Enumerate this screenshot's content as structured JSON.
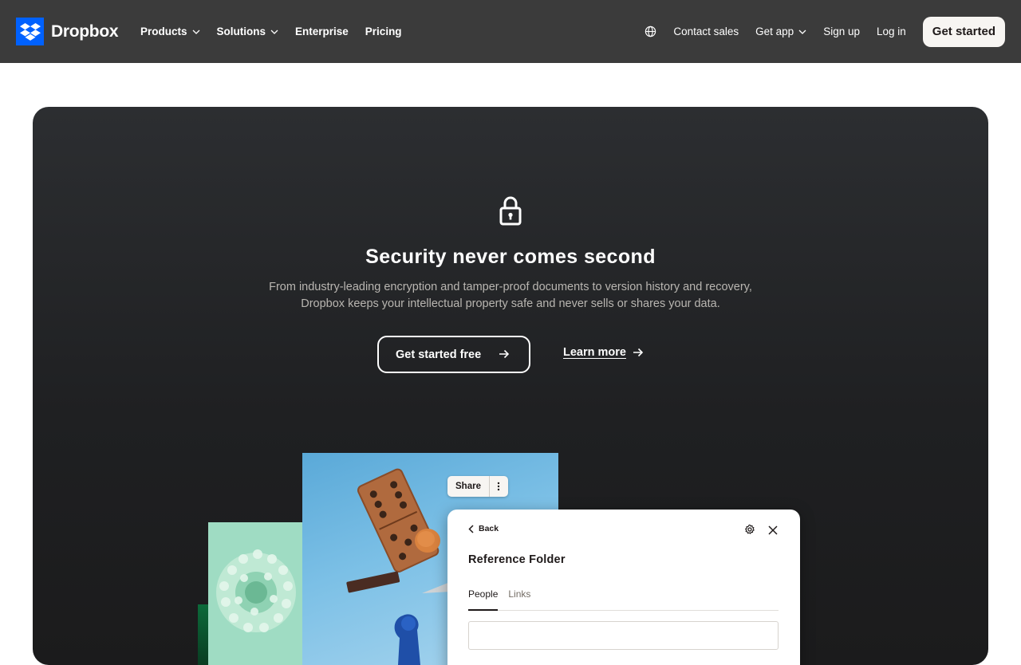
{
  "nav": {
    "brand": "Dropbox",
    "links": [
      "Products",
      "Solutions",
      "Enterprise",
      "Pricing"
    ],
    "right": {
      "contact": "Contact sales",
      "get_app": "Get app",
      "sign_up": "Sign up",
      "log_in": "Log in",
      "cta": "Get started"
    },
    "brand_color": "#0061fe",
    "icons": [
      "dropbox-logo-icon",
      "chevron-down-icon",
      "globe-icon"
    ]
  },
  "hero": {
    "title": "Security never comes second",
    "subtitle_line1": "From industry-leading encryption and tamper-proof documents to version history and recovery,",
    "subtitle_line2": "Dropbox keeps your intellectual property safe and never sells or shares your data.",
    "primary_cta": "Get started free",
    "secondary_cta": "Learn more",
    "icons": [
      "lock-icon",
      "arrow-right-icon"
    ]
  },
  "preview": {
    "share_label": "Share",
    "back_label": "Back",
    "folder_title": "Reference Folder",
    "tabs": [
      {
        "label": "People",
        "active": true
      },
      {
        "label": "Links",
        "active": false
      }
    ],
    "icons": [
      "more-vertical-icon",
      "chevron-left-icon",
      "gear-icon",
      "close-icon"
    ]
  }
}
